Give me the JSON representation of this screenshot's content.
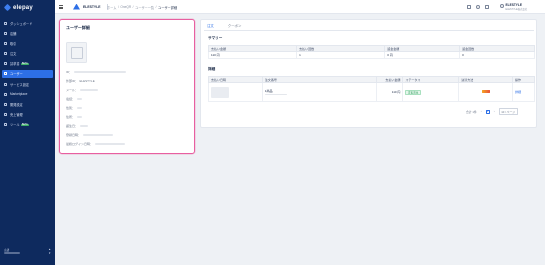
{
  "app": {
    "name": "elepay"
  },
  "sidebar": {
    "items": [
      {
        "label": "ダッシュボード",
        "active": false,
        "badge": ""
      },
      {
        "label": "店舗",
        "active": false,
        "badge": ""
      },
      {
        "label": "取引",
        "active": false,
        "badge": ""
      },
      {
        "label": "注文",
        "active": false,
        "badge": ""
      },
      {
        "label": "請求書",
        "active": false,
        "badge": "BETA"
      },
      {
        "label": "ユーザー",
        "active": true,
        "badge": ""
      },
      {
        "label": "サービス設定",
        "active": false,
        "badge": ""
      },
      {
        "label": "Marketplace",
        "active": false,
        "badge": ""
      },
      {
        "label": "開発設定",
        "active": false,
        "badge": ""
      },
      {
        "label": "売上管理",
        "active": false,
        "badge": ""
      },
      {
        "label": "ツール",
        "active": false,
        "badge": "BETA"
      }
    ],
    "footer_label": "言語",
    "lang_up": "▲",
    "lang_down": "▼"
  },
  "header": {
    "brand_name": "ELESTYLE",
    "breadcrumbs": [
      "ホーム",
      "OneQR",
      "ユーザー一覧",
      "ユーザー詳細"
    ],
    "separator": "/",
    "account_name": "ELESTYLE",
    "account_sub": "ELESTYLE株式会社"
  },
  "user_card": {
    "title": "ユーザー詳細",
    "fields": [
      {
        "label": "ID：",
        "value": ""
      },
      {
        "label": "外部ID：",
        "value": "ELESTYLE"
      },
      {
        "label": "メール：",
        "value": ""
      },
      {
        "label": "電話：",
        "value": ""
      },
      {
        "label": "性別：",
        "value": ""
      },
      {
        "label": "住所：",
        "value": ""
      },
      {
        "label": "誕生日：",
        "value": ""
      },
      {
        "label": "登録日時：",
        "value": ""
      },
      {
        "label": "最終ログイン日時：",
        "value": ""
      }
    ]
  },
  "tabs": [
    {
      "label": "注文",
      "active": true
    },
    {
      "label": "クーポン",
      "active": false
    }
  ],
  "summary": {
    "title": "サマリー",
    "headers": [
      "支払い金額",
      "支払い回数",
      "返金金額",
      "返金回数"
    ],
    "row": [
      "110 円",
      "1",
      "0 円",
      "0"
    ]
  },
  "detail": {
    "title": "詳細",
    "headers": [
      "支払い日時",
      "注文番号",
      "支払い金額",
      "ステータス",
      "決済方法",
      "操作"
    ],
    "rows": [
      {
        "order_no": "1商品",
        "amount": "110 円",
        "status": "支払済み",
        "method_logo": "pay-logo",
        "action": "詳細"
      }
    ]
  },
  "pagination": {
    "total": "合計 1件",
    "prev": "‹",
    "page": "1",
    "next": "›",
    "page_size": "10 / ページ"
  },
  "colors": {
    "sidebar": "#0e2a5e",
    "accent": "#2d6fe6",
    "highlight": "#e85fa0",
    "success": "#2c9a5a"
  }
}
